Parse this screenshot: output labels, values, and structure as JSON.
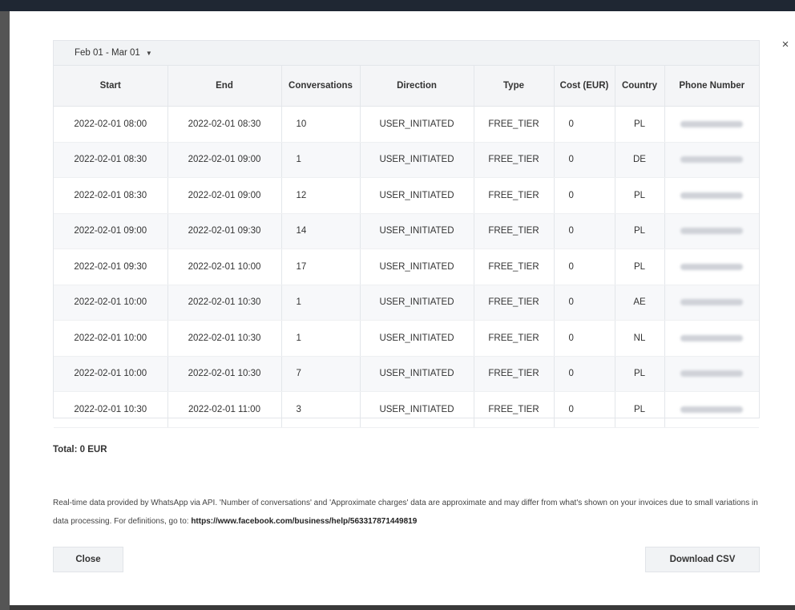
{
  "modal": {
    "date_range": "Feb 01 - Mar 01",
    "close_icon": "×"
  },
  "table": {
    "columns": [
      "Start",
      "End",
      "Conversations",
      "Direction",
      "Type",
      "Cost (EUR)",
      "Country",
      "Phone Number"
    ],
    "rows": [
      {
        "start": "2022-02-01 08:00",
        "end": "2022-02-01 08:30",
        "conversations": "10",
        "direction": "USER_INITIATED",
        "type": "FREE_TIER",
        "cost": "0",
        "country": "PL"
      },
      {
        "start": "2022-02-01 08:30",
        "end": "2022-02-01 09:00",
        "conversations": "1",
        "direction": "USER_INITIATED",
        "type": "FREE_TIER",
        "cost": "0",
        "country": "DE"
      },
      {
        "start": "2022-02-01 08:30",
        "end": "2022-02-01 09:00",
        "conversations": "12",
        "direction": "USER_INITIATED",
        "type": "FREE_TIER",
        "cost": "0",
        "country": "PL"
      },
      {
        "start": "2022-02-01 09:00",
        "end": "2022-02-01 09:30",
        "conversations": "14",
        "direction": "USER_INITIATED",
        "type": "FREE_TIER",
        "cost": "0",
        "country": "PL"
      },
      {
        "start": "2022-02-01 09:30",
        "end": "2022-02-01 10:00",
        "conversations": "17",
        "direction": "USER_INITIATED",
        "type": "FREE_TIER",
        "cost": "0",
        "country": "PL"
      },
      {
        "start": "2022-02-01 10:00",
        "end": "2022-02-01 10:30",
        "conversations": "1",
        "direction": "USER_INITIATED",
        "type": "FREE_TIER",
        "cost": "0",
        "country": "AE"
      },
      {
        "start": "2022-02-01 10:00",
        "end": "2022-02-01 10:30",
        "conversations": "1",
        "direction": "USER_INITIATED",
        "type": "FREE_TIER",
        "cost": "0",
        "country": "NL"
      },
      {
        "start": "2022-02-01 10:00",
        "end": "2022-02-01 10:30",
        "conversations": "7",
        "direction": "USER_INITIATED",
        "type": "FREE_TIER",
        "cost": "0",
        "country": "PL"
      },
      {
        "start": "2022-02-01 10:30",
        "end": "2022-02-01 11:00",
        "conversations": "3",
        "direction": "USER_INITIATED",
        "type": "FREE_TIER",
        "cost": "0",
        "country": "PL"
      }
    ]
  },
  "total": "Total: 0 EUR",
  "disclaimer": {
    "text": "Real-time data provided by WhatsApp via API. 'Number of conversations' and 'Approximate charges' data are approximate and may differ from what's shown on your invoices due to small variations in data processing. For definitions, go to: ",
    "link": "https://www.facebook.com/business/help/563317871449819"
  },
  "buttons": {
    "close": "Close",
    "download": "Download CSV"
  }
}
